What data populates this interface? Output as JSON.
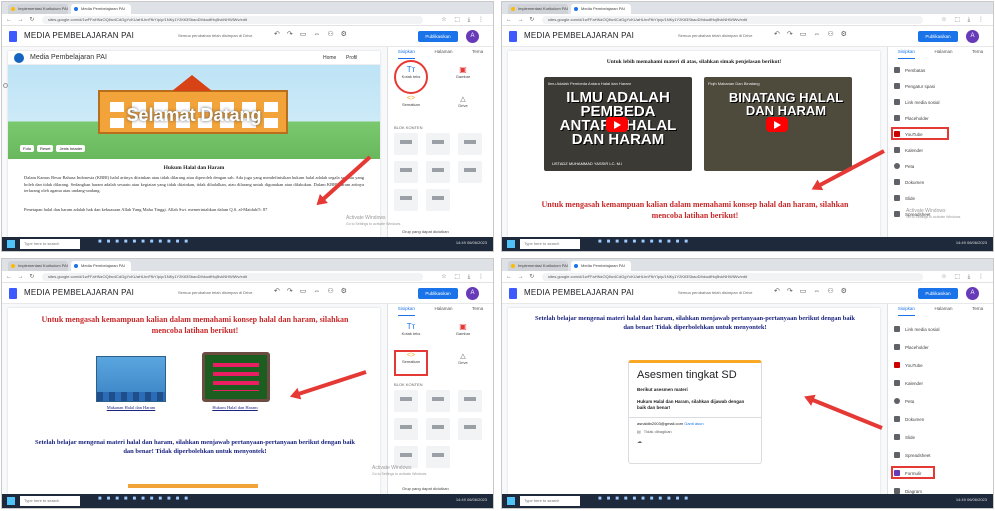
{
  "browser": {
    "tab_blog": "Implementasi Kurikulum PAI",
    "tab_sites": "Media Pembelajaran PAI",
    "url": "sites.google.com/d/1wFFaHNzOQlhv4CdGgYcKUaHLhnFfkYIp/p/1NKy1Y2Ktl3SbaoDIhkudfHqBvkNHWiWv/edit"
  },
  "sites_header": {
    "doc_title": "MEDIA PEMBELAJARAN PAI",
    "saved_status": "Semua perubahan telah disimpan di Drive",
    "publish_label": "Publikasikan",
    "avatar_initial": "A"
  },
  "side_tabs": {
    "insert": "Sisipkan",
    "pages": "Halaman",
    "themes": "Tema"
  },
  "side_widgets": {
    "text_box": "Kotak teks",
    "images": "Gambar",
    "embed": "Sematkan",
    "drive": "Drive",
    "layouts": "BLOK KONTEN",
    "collapsible": "Grup yang dapat diciutkan"
  },
  "side_list": [
    "Pembatas",
    "Pengatur spasi",
    "Link media sosial",
    "Placeholder",
    "YouTube",
    "Kalender",
    "Peta",
    "Dokumen",
    "Slide",
    "Spreadsheet",
    "Formulir",
    "Diagram"
  ],
  "site_page": {
    "site_name": "Media Pembelajaran PAI",
    "nav_home": "Home",
    "nav_profile": "Profil",
    "banner_text": "Selamat Datang",
    "header_btn_logo": "Foto",
    "header_btn_reset": "Reset",
    "header_btn_type": "Jenis header",
    "heading": "Hukum Halal dan Haram",
    "para1": "Dalam Kamus Besar Bahasa Indonesia (KBBI) halal artinya diizinkan atau tidak dilarang atau diperoleh dengan sah. Ada juga yang mendefinisikan hukum halal adalah segala sesuatu yang boleh dan tidak dilarang. Sedangkan haram adalah sesuatu atau kegiatan yang tidak diizinkan, tidak dihalalkan, atau dilarang untuk digunakan atau dilakukan. Dalam KBBI haram artinya terlarang oleh agama atau undang-undang.",
    "para2": "Penetapan halal dan haram adalah hak dan kekuasaan Allah Yang Maha Tinggi. Allah Swt. memerintahkan dalam Q.S. al-Maidah/5: 87"
  },
  "video_page": {
    "intro": "Untuk lebih memahami materi di atas, silahkan simak penjelasan berikut!",
    "video1_title": "ILMU ADALAH PEMBEDA ANTARA HALAL DAN HARAM",
    "video1_caption": "Ilmu Adalah Pembeda Antara Halal dan Haram",
    "video1_author": "USTADZ MUHAMMAD YASSIR LC. M.I",
    "video2_title": "BINATANG HALAL DAN HARAM",
    "video2_caption": "Fiqih Makanan Dan Binatang",
    "prompt": "Untuk mengasah kemampuan kalian dalam memahami konsep halal dan haram, silahkan mencoba latihan berikut!"
  },
  "game_page": {
    "prompt": "Untuk mengasah kemampuan kalian dalam memahami konsep halal dan haram, silahkan mencoba latihan berikut!",
    "game1_label": "Makanan Halal dan Haram",
    "game2_label": "Hukum Halal dan Haram",
    "assess_prompt": "Setelah belajar mengenai materi halal dan haram, silahkan menjawab pertanyaan-pertanyaan berikut dengan baik dan benar! Tidak diperbolehkan untuk menyontek!"
  },
  "form_page": {
    "prompt": "Setelah belajar mengenai materi halal dan haram, silahkan menjawab pertanyaan-pertanyaan berikut dengan baik dan benar! Tidak diperbolehkan untuk menyontek!",
    "form_title": "Asesmen tingkat SD",
    "form_greeting": "Berikut asesmen materi",
    "form_desc": "Hukum Halal dan Haram, silahkan dijawab dengan baik dan benar!",
    "account_email": "asnaldin2003@gmail.com",
    "switch_account": "Ganti akun",
    "not_shared": "Tidak dibagikan"
  },
  "taskbar": {
    "search_placeholder": "Type here to search",
    "time": "14:49",
    "date": "06/06/2023"
  },
  "activate_windows": {
    "line1": "Activate Windows",
    "line2": "Go to Settings to activate Windows."
  },
  "colors": {
    "accent": "#1a73e8",
    "highlight": "#e53935",
    "headline": "#c62828"
  }
}
